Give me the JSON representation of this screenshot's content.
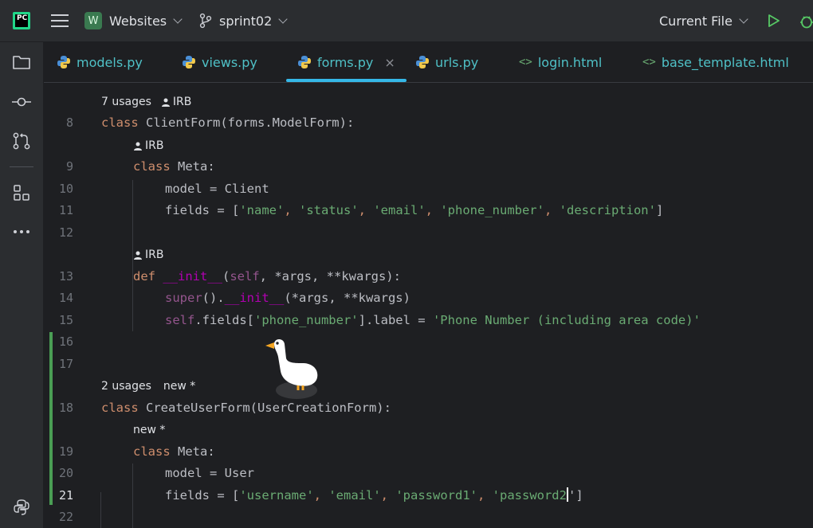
{
  "titlebar": {
    "app_icon_text": "PC",
    "project_initial": "W",
    "project_name": "Websites",
    "branch": "sprint02",
    "run_config": "Current File"
  },
  "tabs": [
    {
      "label": "models.py",
      "kind": "python"
    },
    {
      "label": "views.py",
      "kind": "python"
    },
    {
      "label": "forms.py",
      "kind": "python",
      "active": true,
      "close": "×"
    },
    {
      "label": "urls.py",
      "kind": "python"
    },
    {
      "label": "login.html",
      "kind": "html",
      "icon": "<>"
    },
    {
      "label": "base_template.html",
      "kind": "html",
      "icon": "<>"
    }
  ],
  "hints": {
    "h1_usages": "7 usages",
    "h1_author": "IRB",
    "h2_author": "IRB",
    "h3_author": "IRB",
    "h4_usages": "2 usages",
    "h4_status": "new *",
    "h5_status": "new *"
  },
  "line_numbers": [
    "8",
    "9",
    "10",
    "11",
    "12",
    "13",
    "14",
    "15",
    "16",
    "17",
    "18",
    "19",
    "20",
    "21",
    "22"
  ],
  "code": {
    "l8": {
      "kw": "class",
      "name": " ClientForm(forms.ModelForm):"
    },
    "l9": {
      "kw": "class",
      "name": " Meta:"
    },
    "l10": "model = Client",
    "l11": {
      "pre": "fields = [",
      "s1": "'name'",
      "c1": ", ",
      "s2": "'status'",
      "c2": ", ",
      "s3": "'email'",
      "c3": ", ",
      "s4": "'phone_number'",
      "c4": ", ",
      "s5": "'description'",
      "post": "]"
    },
    "l13": {
      "kw": "def",
      "sp": " ",
      "dund": "__init__",
      "p1": "(",
      "self": "self",
      "rest": ", *args, **kwargs):"
    },
    "l14": {
      "fn": "super",
      "p1": "().",
      "dund": "__init__",
      "rest": "(*args, **kwargs)"
    },
    "l15": {
      "self": "self",
      "p1": ".fields[",
      "s1": "'phone_number'",
      "p2": "].label = ",
      "s2": "'Phone Number (including area code)'"
    },
    "l18": {
      "kw": "class",
      "name": " CreateUserForm(UserCreationForm):"
    },
    "l19": {
      "kw": "class",
      "name": " Meta:"
    },
    "l20": "model = User",
    "l21": {
      "pre": "fields = [",
      "s1": "'username'",
      "c1": ", ",
      "s2": "'email'",
      "c2": ", ",
      "s3": "'password1'",
      "c3": ", ",
      "s4": "'password2",
      "post": "']"
    }
  },
  "colors": {
    "keyword": "#cf8e6d",
    "string": "#6aab73",
    "self": "#94558d",
    "dunder": "#b200b2",
    "builtin": "#56a8f5",
    "current_line": "#0c0e7d",
    "tab_accent": "#35b8e8"
  }
}
